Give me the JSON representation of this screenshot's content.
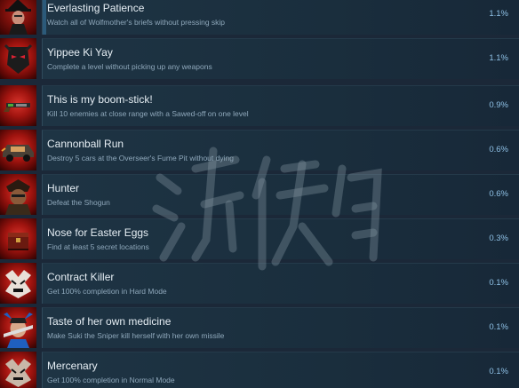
{
  "achievements": [
    {
      "title": "Everlasting Patience",
      "description": "Watch all of Wolfmother's briefs without pressing skip",
      "percent": "1.1%",
      "icon": "wolfmother-icon"
    },
    {
      "title": "Yippee Ki Yay",
      "description": "Complete a level without picking up any weapons",
      "percent": "1.1%",
      "icon": "masked-face-icon"
    },
    {
      "title": "This is my boom-stick!",
      "description": "Kill 10 enemies at close range with a Sawed-off on one level",
      "percent": "0.9%",
      "icon": "shotgun-icon"
    },
    {
      "title": "Cannonball Run",
      "description": "Destroy 5 cars at the Overseer's Fume Pit without dying",
      "percent": "0.6%",
      "icon": "car-icon"
    },
    {
      "title": "Hunter",
      "description": "Defeat the Shogun",
      "percent": "0.6%",
      "icon": "shogun-icon"
    },
    {
      "title": "Nose for Easter Eggs",
      "description": "Find at least 5 secret locations",
      "percent": "0.3%",
      "icon": "treasure-chest-icon"
    },
    {
      "title": "Contract Killer",
      "description": "Get 100% completion in Hard Mode",
      "percent": "0.1%",
      "icon": "contract-killer-icon"
    },
    {
      "title": "Taste of her own medicine",
      "description": "Make Suki the Sniper kill herself with her own missile",
      "percent": "0.1%",
      "icon": "suki-icon"
    },
    {
      "title": "Mercenary",
      "description": "Get 100% completion in Normal Mode",
      "percent": "0.1%",
      "icon": "mercenary-icon"
    }
  ],
  "colors": {
    "background": "#1b2838",
    "card": "#1a2e3d",
    "title": "#e6eef4",
    "description": "#8fa8bb",
    "percent": "#8fc1e6",
    "icon_red": "#a0140f"
  },
  "watermark": {
    "text": "游侠网"
  }
}
